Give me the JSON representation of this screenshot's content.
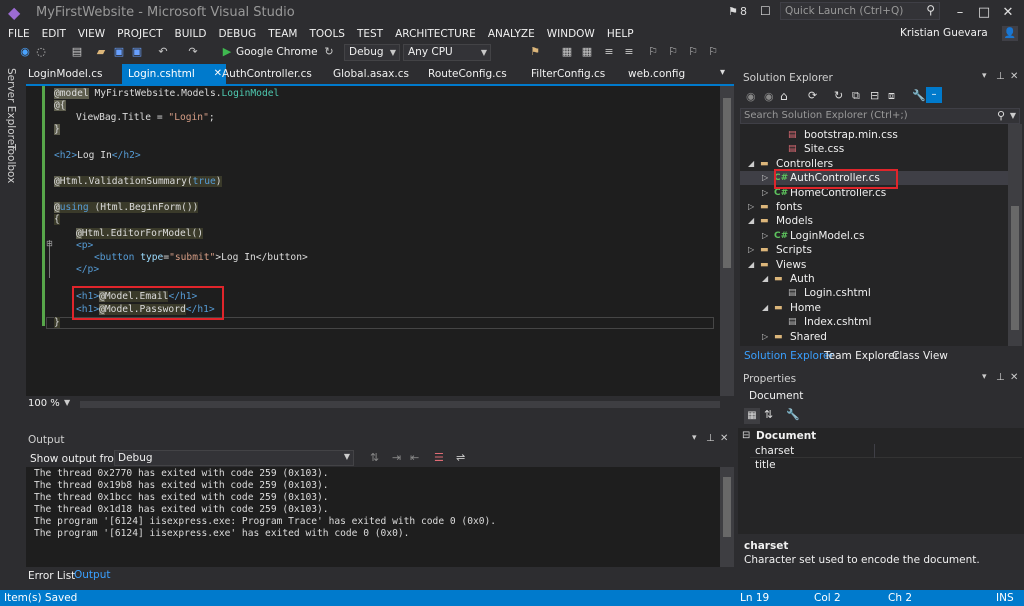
{
  "window": {
    "title": "MyFirstWebsite - Microsoft Visual Studio",
    "notification_count": "8",
    "quick_launch_placeholder": "Quick Launch (Ctrl+Q)",
    "user": "Kristian Guevara"
  },
  "menu": [
    "FILE",
    "EDIT",
    "VIEW",
    "PROJECT",
    "BUILD",
    "DEBUG",
    "TEAM",
    "TOOLS",
    "TEST",
    "ARCHITECTURE",
    "ANALYZE",
    "WINDOW",
    "HELP"
  ],
  "toolbar": {
    "run_target": "Google Chrome",
    "configuration": "Debug",
    "platform": "Any CPU"
  },
  "left_strip": {
    "server_explorer": "Server Explorer",
    "toolbox": "Toolbox"
  },
  "tabs": [
    "LoginModel.cs",
    "Login.cshtml",
    "AuthController.cs",
    "Global.asax.cs",
    "RouteConfig.cs",
    "FilterConfig.cs",
    "web.config"
  ],
  "active_tab": "Login.cshtml",
  "code": {
    "l1_a": "@model",
    "l1_b": "MyFirstWebsite.Models.",
    "l1_c": "LoginModel",
    "l2": "@{",
    "l3_a": "ViewBag.Title = ",
    "l3_b": "\"Login\"",
    "l3_c": ";",
    "l4": "}",
    "l5_a": "<h2>",
    "l5_b": "Log In",
    "l5_c": "</h2>",
    "l6_a": "@",
    "l6_b": "Html.ValidationSummary(",
    "l6_c": "true",
    "l6_d": ")",
    "l7_a": "@",
    "l7_b": "using",
    "l7_c": " (Html.BeginForm())",
    "l8": "{",
    "l9_a": "@",
    "l9_b": "Html.EditorForModel()",
    "l10": "<p>",
    "l11_a": "<button ",
    "l11_b": "type",
    "l11_c": "=",
    "l11_d": "\"submit\"",
    "l11_e": ">Log In</button>",
    "l12": "</p>",
    "l13_a": "<h1>",
    "l13_b": "@",
    "l13_c": "Model.Email",
    "l13_d": "</h1>",
    "l14_a": "<h1>",
    "l14_b": "@",
    "l14_c": "Model.Password",
    "l14_d": "</h1>",
    "l15": "}"
  },
  "zoom": "100 %",
  "output": {
    "title": "Output",
    "show_from_label": "Show output from:",
    "source": "Debug",
    "lines": [
      "The thread 0x2770 has exited with code 259 (0x103).",
      "The thread 0x19b8 has exited with code 259 (0x103).",
      "The thread 0x1bcc has exited with code 259 (0x103).",
      "The thread 0x1d18 has exited with code 259 (0x103).",
      "The program '[6124] iisexpress.exe: Program Trace' has exited with code 0 (0x0).",
      "The program '[6124] iisexpress.exe' has exited with code 0 (0x0)."
    ]
  },
  "bottom_tabs": [
    "Error List",
    "Output"
  ],
  "solution_explorer": {
    "title": "Solution Explorer",
    "search_placeholder": "Search Solution Explorer (Ctrl+;)",
    "tree": [
      {
        "label": "bootstrap.min.css",
        "depth": 3,
        "icon": "css-file-icon",
        "expander": ""
      },
      {
        "label": "Site.css",
        "depth": 3,
        "icon": "css-file-icon",
        "expander": ""
      },
      {
        "label": "Controllers",
        "depth": 1,
        "icon": "folder-icon",
        "expander": "◢"
      },
      {
        "label": "AuthController.cs",
        "depth": 2,
        "icon": "csharp-file-icon",
        "expander": "▷"
      },
      {
        "label": "HomeController.cs",
        "depth": 2,
        "icon": "csharp-file-icon",
        "expander": "▷"
      },
      {
        "label": "fonts",
        "depth": 1,
        "icon": "folder-icon",
        "expander": "▷"
      },
      {
        "label": "Models",
        "depth": 1,
        "icon": "folder-icon",
        "expander": "◢"
      },
      {
        "label": "LoginModel.cs",
        "depth": 2,
        "icon": "csharp-file-icon",
        "expander": "▷"
      },
      {
        "label": "Scripts",
        "depth": 1,
        "icon": "folder-icon",
        "expander": "▷"
      },
      {
        "label": "Views",
        "depth": 1,
        "icon": "folder-icon",
        "expander": "◢"
      },
      {
        "label": "Auth",
        "depth": 2,
        "icon": "folder-icon",
        "expander": "◢"
      },
      {
        "label": "Login.cshtml",
        "depth": 3,
        "icon": "cshtml-file-icon",
        "expander": ""
      },
      {
        "label": "Home",
        "depth": 2,
        "icon": "folder-icon",
        "expander": "◢"
      },
      {
        "label": "Index.cshtml",
        "depth": 3,
        "icon": "cshtml-file-icon",
        "expander": ""
      },
      {
        "label": "Shared",
        "depth": 2,
        "icon": "folder-icon",
        "expander": "▷"
      }
    ],
    "selected": "AuthController.cs",
    "bottom_tabs": [
      "Solution Explorer",
      "Team Explorer",
      "Class View"
    ]
  },
  "properties": {
    "title": "Properties",
    "object": "Document",
    "category": "Document",
    "rows": [
      "charset",
      "title"
    ],
    "desc_title": "charset",
    "desc_text": "Character set used to encode the document."
  },
  "status": {
    "message": "Item(s) Saved",
    "ln": "Ln 19",
    "col": "Col 2",
    "ch": "Ch 2",
    "mode": "INS"
  },
  "colors": {
    "accent": "#007acc",
    "background": "#2d2d30",
    "editor_bg": "#1e1e1e",
    "highlight_box": "#e0252b"
  }
}
